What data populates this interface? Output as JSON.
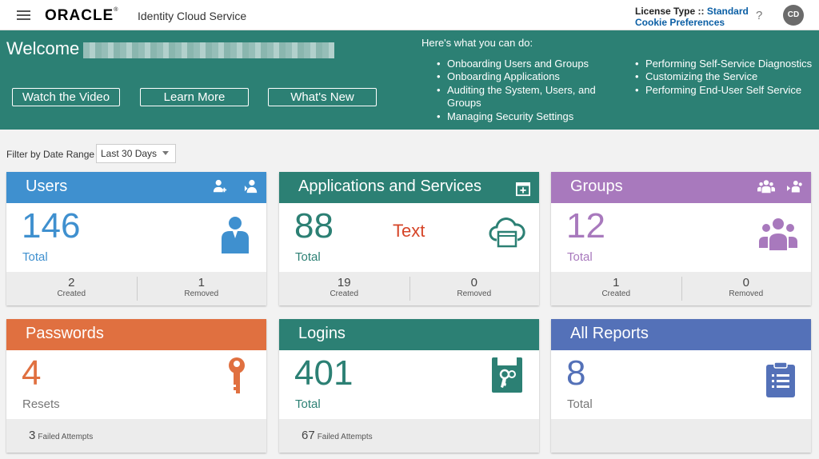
{
  "topbar": {
    "logo": "ORACLE",
    "product": "Identity Cloud Service",
    "license_prefix": "License Type :: ",
    "license_value": "Standard",
    "cookie": "Cookie Preferences",
    "help": "?",
    "avatar": "CD"
  },
  "banner": {
    "welcome": "Welcome",
    "buttons": [
      "Watch the Video",
      "Learn More",
      "What's New"
    ],
    "what_title": "Here's what you can do:",
    "list1": [
      "Onboarding Users and Groups",
      "Onboarding Applications",
      "Auditing the System, Users, and Groups",
      "Managing Security Settings"
    ],
    "list2": [
      "Performing Self-Service Diagnostics",
      "Customizing the Service",
      "Performing End-User Self Service"
    ]
  },
  "filter": {
    "label": "Filter by Date Range",
    "value": "Last 30 Days"
  },
  "cards": {
    "users": {
      "title": "Users",
      "value": "146",
      "sub": "Total",
      "c1": "2",
      "c1l": "Created",
      "c2": "1",
      "c2l": "Removed",
      "color": "#3f90cf"
    },
    "apps": {
      "title": "Applications and Services",
      "value": "88",
      "sub": "Total",
      "c1": "19",
      "c1l": "Created",
      "c2": "0",
      "c2l": "Removed",
      "overlay": "Text",
      "color": "#2c8074"
    },
    "groups": {
      "title": "Groups",
      "value": "12",
      "sub": "Total",
      "c1": "1",
      "c1l": "Created",
      "c2": "0",
      "c2l": "Removed",
      "color": "#a879bd"
    },
    "passwords": {
      "title": "Passwords",
      "value": "4",
      "sub": "Resets",
      "fail_n": "3",
      "fail_l": "Failed Attempts",
      "color": "#e07040"
    },
    "logins": {
      "title": "Logins",
      "value": "401",
      "sub": "Total",
      "fail_n": "67",
      "fail_l": "Failed Attempts",
      "color": "#2c8074"
    },
    "reports": {
      "title": "All Reports",
      "value": "8",
      "sub": "Total",
      "color": "#5471b8"
    }
  },
  "icons": [
    "menu-icon",
    "help-icon",
    "add-user-icon",
    "import-user-icon",
    "user-icon",
    "add-app-icon",
    "cloud-app-icon",
    "add-group-icon",
    "import-group-icon",
    "group-icon",
    "key-icon",
    "login-icon",
    "report-icon"
  ]
}
